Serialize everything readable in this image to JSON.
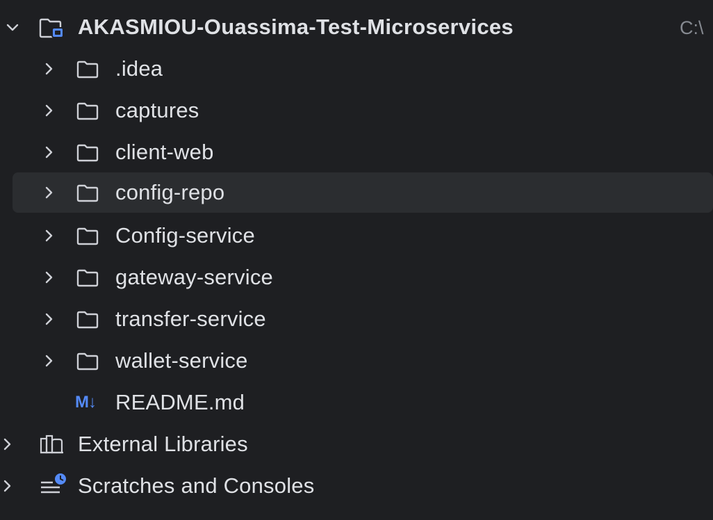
{
  "project": {
    "name": "AKASMIOU-Ouassima-Test-Microservices",
    "path": "C:\\",
    "expanded": true
  },
  "folders": [
    {
      "label": ".idea"
    },
    {
      "label": "captures"
    },
    {
      "label": "client-web"
    },
    {
      "label": "config-repo",
      "hovered": true
    },
    {
      "label": "Config-service"
    },
    {
      "label": "gateway-service"
    },
    {
      "label": "transfer-service"
    },
    {
      "label": "wallet-service"
    }
  ],
  "files": [
    {
      "label": "README.md",
      "badge": "M↓",
      "icon": "markdown-icon"
    }
  ],
  "roots": [
    {
      "label": "External Libraries",
      "icon": "library-icon"
    },
    {
      "label": "Scratches and Consoles",
      "icon": "scratches-icon"
    }
  ],
  "colors": {
    "background": "#1e1f22",
    "hover_row": "#2b2d30",
    "text": "#dfe1e5",
    "path_text": "#868a91",
    "accent_blue": "#548af7",
    "icon": "#ced0d6"
  }
}
